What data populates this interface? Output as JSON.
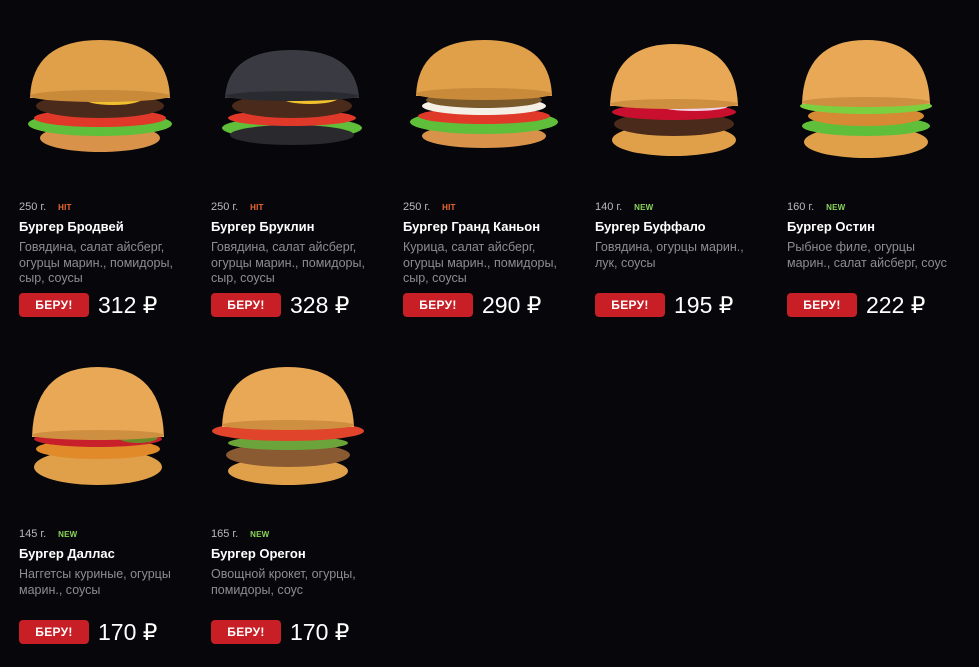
{
  "menu": {
    "items": [
      {
        "weight": "250 г.",
        "badge": "HIT",
        "name": "Бургер Бродвей",
        "desc": "Говядина, салат айсберг, огурцы марин., помидоры, сыр, соусы",
        "button": "БЕРУ!",
        "price": "312 ₽"
      },
      {
        "weight": "250 г.",
        "badge": "HIT",
        "name": "Бургер Бруклин",
        "desc": "Говядина, салат айсберг, огурцы марин., помидоры, сыр, соусы",
        "button": "БЕРУ!",
        "price": "328 ₽"
      },
      {
        "weight": "250 г.",
        "badge": "HIT",
        "name": "Бургер Гранд Каньон",
        "desc": "Курица, салат айсберг, огурцы марин., помидоры, сыр, соусы",
        "button": "БЕРУ!",
        "price": "290 ₽"
      },
      {
        "weight": "140 г.",
        "badge": "NEW",
        "name": "Бургер Буффало",
        "desc": "Говядина, огурцы марин., лук, соусы",
        "button": "БЕРУ!",
        "price": "195 ₽"
      },
      {
        "weight": "160 г.",
        "badge": "NEW",
        "name": "Бургер Остин",
        "desc": "Рыбное филе, огурцы марин., салат айсберг, соус",
        "button": "БЕРУ!",
        "price": "222 ₽"
      },
      {
        "weight": "145 г.",
        "badge": "NEW",
        "name": "Бургер Даллас",
        "desc": "Наггетсы куриные, огурцы марин., соусы",
        "button": "БЕРУ!",
        "price": "170 ₽"
      },
      {
        "weight": "165 г.",
        "badge": "NEW",
        "name": "Бургер Орегон",
        "desc": "Овощной крокет, огурцы, помидоры, соус",
        "button": "БЕРУ!",
        "price": "170 ₽"
      }
    ]
  },
  "colors": {
    "background": "#07070b",
    "button": "#c81e25",
    "hit_badge": "#f06a32",
    "new_badge": "#8bd45a"
  }
}
